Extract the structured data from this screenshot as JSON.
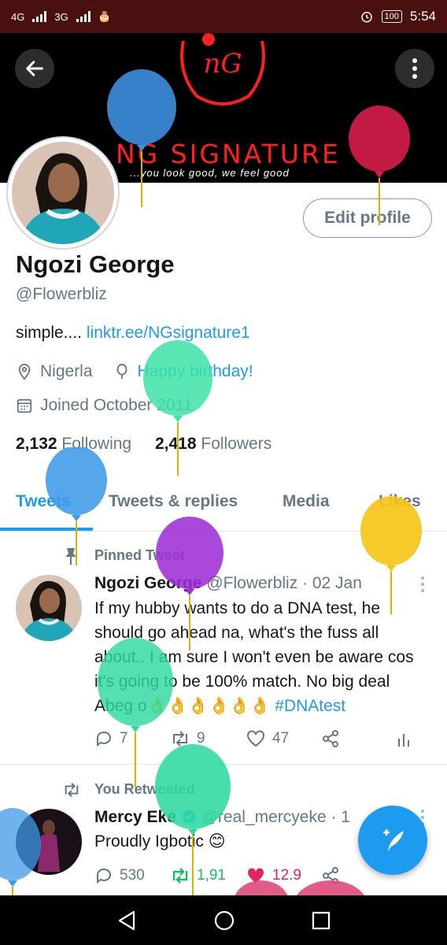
{
  "status_bar": {
    "network_1": "4G",
    "network_2": "3G",
    "battery": "100",
    "time": "5:54"
  },
  "banner": {
    "logo_text": "nG",
    "brand_name": "NG SIGNATURE",
    "tagline": "...you look good, we feel good"
  },
  "profile": {
    "edit_profile_label": "Edit profile",
    "display_name": "Ngozi George",
    "handle": "@Flowerbliz",
    "bio_text": "simple.... ",
    "bio_link": "linktr.ee/NGsignature1",
    "location": "Nigerla",
    "birthday_text": "Happy birthday!",
    "joined": "Joined October 2011",
    "following_count": "2,132",
    "following_label": "Following",
    "followers_count": "2,418",
    "followers_label": "Followers"
  },
  "tabs": [
    {
      "label": "Tweets",
      "active": true
    },
    {
      "label": "Tweets & replies",
      "active": false
    },
    {
      "label": "Media",
      "active": false
    },
    {
      "label": "Likes",
      "active": false
    }
  ],
  "pinned_tweet": {
    "label": "Pinned Tweet",
    "name": "Ngozi George",
    "handle_date": "@Flowerbliz · 02 Jan",
    "text": "If my hubby wants to do a DNA test, he should go ahead na, what's the fuss all about.. I am sure I won't even be aware cos it's going to be 100% match. No big deal Abeg o👌👌👌👌👌👌 ",
    "hashtag": "#DNAtest",
    "replies": "7",
    "retweets": "9",
    "likes": "47"
  },
  "retweet": {
    "label": "You Retweeted",
    "name": "Mercy Eke",
    "handle": "@real_mercyeke · 1",
    "text": "Proudly Igbotic 😊",
    "replies": "530",
    "retweets": "1,91",
    "likes": "12.9"
  },
  "colors": {
    "accent": "#1d9bf0",
    "retweet_green": "#17bf63",
    "like_red": "#e0245e",
    "status_bar": "#4a0f0f"
  }
}
